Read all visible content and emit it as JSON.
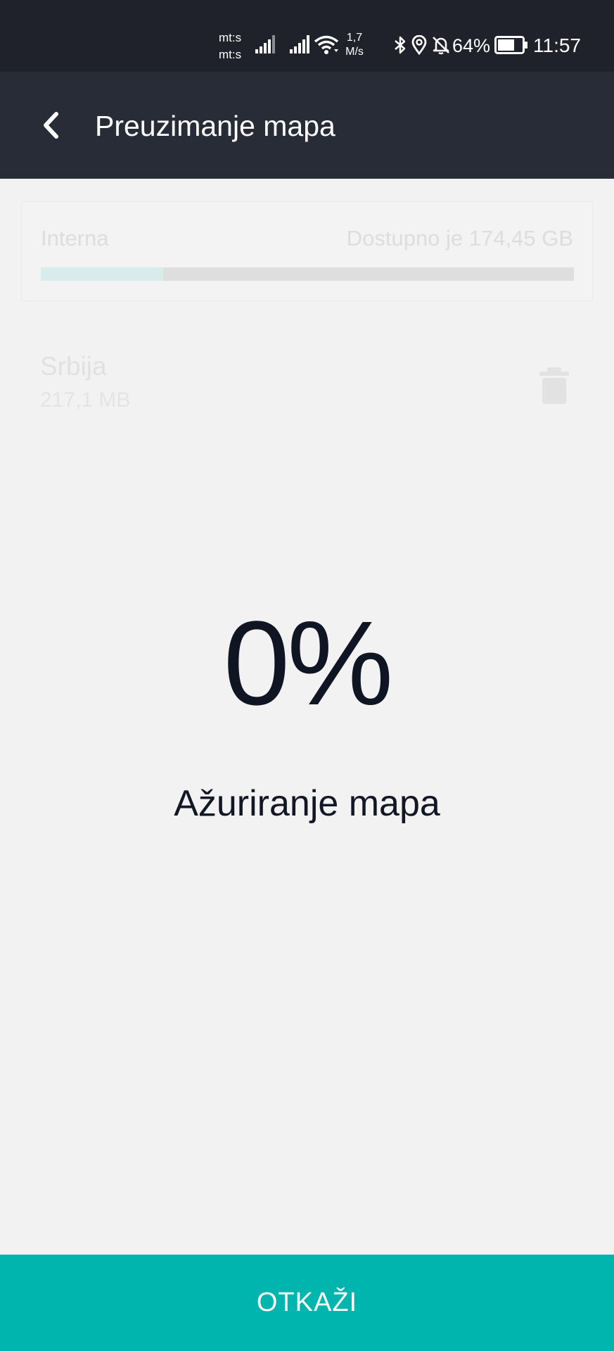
{
  "status_bar": {
    "carrier_1": "mt:s",
    "carrier_2": "mt:s",
    "speed_value": "1,7",
    "speed_unit": "M/s",
    "battery_percent": "64%",
    "time": "11:57",
    "icons": [
      "signal-icon",
      "signal-icon",
      "wifi-icon",
      "bluetooth-icon",
      "location-icon",
      "bell-off-icon",
      "battery-icon"
    ]
  },
  "app_bar": {
    "back_icon": "chevron-left-icon",
    "title": "Preuzimanje mapa"
  },
  "storage": {
    "label": "Interna",
    "available": "Dostupno je 174,45 GB",
    "used_fraction": 0.23,
    "fill_color": "#d8ecec",
    "track_color": "#dedede"
  },
  "map_item": {
    "name": "Srbija",
    "size": "217,1 MB",
    "delete_icon": "trash-icon"
  },
  "progress": {
    "percent_text": "0%",
    "status": "Ažuriranje mapa"
  },
  "footer": {
    "cancel_label": "OTKAŽI",
    "accent_color": "#00b5ae"
  }
}
